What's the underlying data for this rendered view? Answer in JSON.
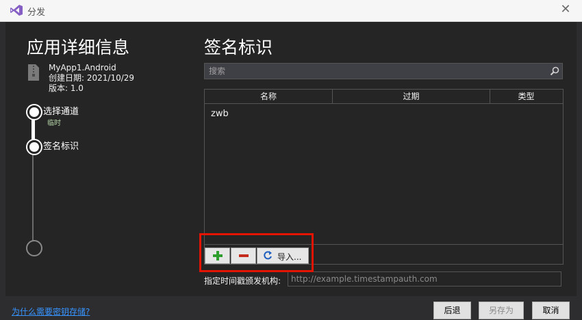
{
  "window": {
    "title": "分发"
  },
  "left": {
    "title": "应用详细信息",
    "app_name": "MyApp1.Android",
    "created_label": "创建日期: 2021/10/29",
    "version_label": "版本: 1.0",
    "steps": [
      {
        "label": "选择通道",
        "sub": "临时"
      },
      {
        "label": "签名标识"
      }
    ]
  },
  "right": {
    "title": "签名标识",
    "search_placeholder": "搜索",
    "table": {
      "headers": [
        "名称",
        "过期",
        "类型"
      ],
      "rows": [
        {
          "name": "zwb",
          "expires": "",
          "type": ""
        }
      ]
    },
    "toolbar": {
      "import_label": "导入..."
    },
    "timestamp_label": "指定时间戳颁发机构:",
    "timestamp_placeholder": "http://example.timestampauth.com"
  },
  "footer": {
    "link": "为什么需要密钥存储?",
    "back": "后退",
    "save_as": "另存为",
    "cancel": "取消"
  },
  "colors": {
    "accent_link": "#3794ff",
    "highlight": "#e51400",
    "add_icon": "#2e9e2e",
    "remove_icon": "#c42b1c"
  }
}
